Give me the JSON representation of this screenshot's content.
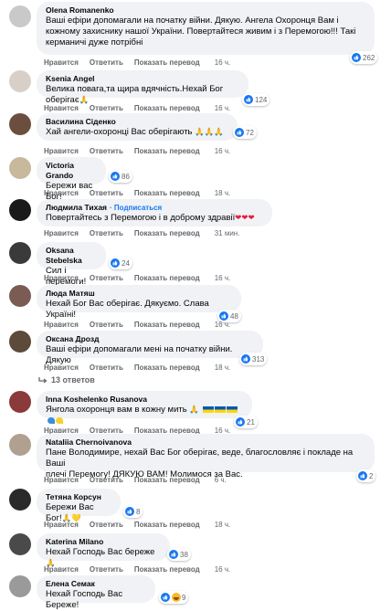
{
  "actions": {
    "like": "Нравится",
    "reply": "Ответить",
    "translate": "Показать перевод"
  },
  "colors": {
    "bubble": "#f0f2f5",
    "secondary_text": "#65676b",
    "like_blue": "#1877f2",
    "heart_red": "#e41e3f",
    "haha_yellow": "#f7b928"
  },
  "comments": [
    {
      "name": "Olena Romanenko",
      "text1": "Ваші ефіри допомагали на початку війни. Дякую. Ангела Охоронця Вам і",
      "text2": "кожному захиснику нашої України. Повертайтеся живим і з Перемогою!!! Такі",
      "text3": "керманичі дуже потрібні",
      "reactions": "262",
      "time": "16 ч.",
      "avatar_color": "#c9c9c9"
    },
    {
      "name": "Ksenia Angel",
      "text1": "Велика повага,та щира вдячність.Нехай Бог оберігає",
      "emoji": "🙏",
      "reactions": "124",
      "time": "16 ч.",
      "avatar_color": "#d8d0c8"
    },
    {
      "name": "Василина Сіденко",
      "text1": "Хай ангели-охоронці Вас оберігають",
      "emoji": "🙏🙏🙏",
      "reactions": "72",
      "time": "16 ч.",
      "avatar_color": "#6b4e3d"
    },
    {
      "name": "Victoria Grando",
      "text1": "Бережи вас Бог!",
      "reactions": "86",
      "time": "18 ч.",
      "avatar_color": "#c8b89c"
    },
    {
      "name": "Людмила Тихая",
      "follower": "· Подписаться",
      "text1": "Повертайтесь з Перемогою і в доброму здравії",
      "emoji": "❤❤❤",
      "time": "31 мин.",
      "avatar_color": "#1a1a1a"
    },
    {
      "name": "Oksana Stebelska",
      "text1": "Сил і перемоги!",
      "reactions": "24",
      "time": "16 ч.",
      "avatar_color": "#3a3a3a"
    },
    {
      "name": "Люда Матяш",
      "text1": "Нехай Бог Вас оберігає. Дякуємо. Слава Україні!",
      "reactions": "48",
      "time": "16 ч.",
      "avatar_color": "#7a5c55"
    },
    {
      "name": "Оксана Дрозд",
      "text1": "Ваші ефіри допомагали мені на початку війни. Дякую",
      "reactions": "313",
      "time": "18 ч.",
      "replies": "13 ответов",
      "avatar_color": "#5c4a3a"
    },
    {
      "name": "Inna Koshelenko Rusanova",
      "text1": "Янгола охоронця вам в кожну мить",
      "emoji": "🙏",
      "reactions": "21",
      "time": "16 ч.",
      "avatar_color": "#8a3a3a"
    },
    {
      "name": "Nataliia Chernoivanova",
      "text1": "Пане Володимире, нехай Вас Бог оберігає, веде, благословляє і покладе на Ваші",
      "text2": "плечі Перемогу! ДЯКУЮ ВАМ! Молимося за Вас.",
      "reactions": "2",
      "time": "6 ч.",
      "avatar_color": "#b0a090"
    },
    {
      "name": "Тетяна Корсун",
      "text1": "Бережи Вас Бог!",
      "emoji": "🙏💛",
      "reactions": "8",
      "time": "18 ч.",
      "avatar_color": "#2a2a2a"
    },
    {
      "name": "Katerina Milano",
      "text1": "Нехай Господь Вас береже",
      "emoji": "🙏",
      "reactions": "38",
      "time": "16 ч.",
      "avatar_color": "#4a4a4a"
    },
    {
      "name": "Елена Семак",
      "text1": "Нехай Господь Вас Береже!",
      "reactions": "9",
      "time": "",
      "avatar_color": "#9a9a9a"
    }
  ]
}
